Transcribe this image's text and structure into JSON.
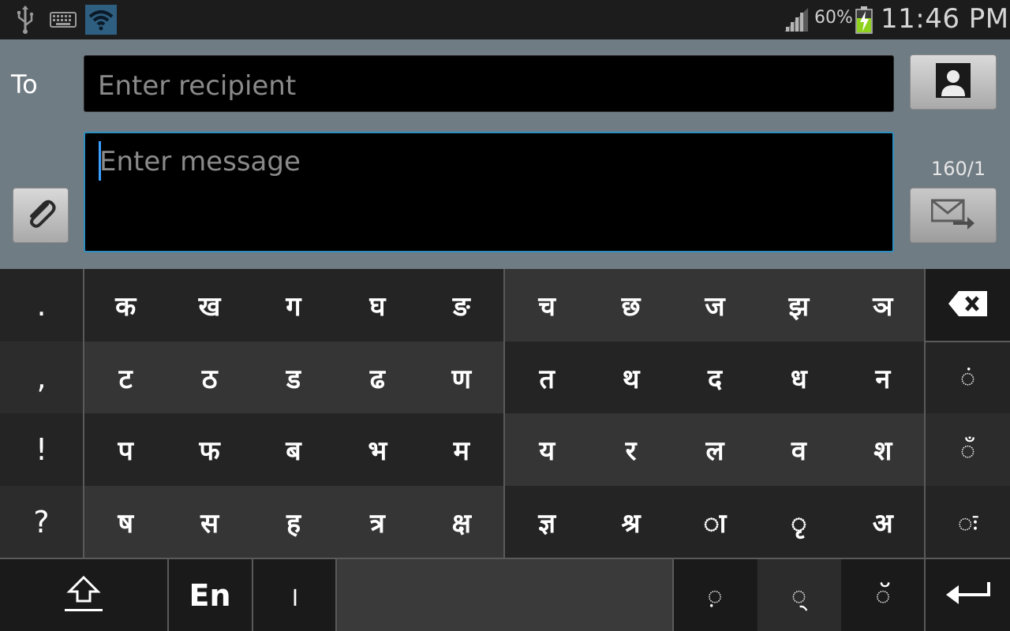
{
  "status_bar": {
    "icons": [
      "usb-icon",
      "keyboard-icon",
      "wifi-icon",
      "signal-icon",
      "battery-charging-icon"
    ],
    "battery_percent": "60%",
    "time": "11:46 PM"
  },
  "compose": {
    "to_label": "To",
    "recipient_placeholder": "Enter recipient",
    "message_placeholder": "Enter message",
    "char_counter": "160/1",
    "contacts_icon": "contact-icon",
    "attach_icon": "paperclip-icon",
    "send_icon": "send-message-icon"
  },
  "keyboard": {
    "left_column": [
      ".",
      ",",
      "!",
      "?"
    ],
    "rows_left": [
      [
        "क",
        "ख",
        "ग",
        "घ",
        "ङ"
      ],
      [
        "ट",
        "ठ",
        "ड",
        "ढ",
        "ण"
      ],
      [
        "प",
        "फ",
        "ब",
        "भ",
        "म"
      ],
      [
        "ष",
        "स",
        "ह",
        "त्र",
        "क्ष"
      ]
    ],
    "rows_right": [
      [
        "च",
        "छ",
        "ज",
        "झ",
        "ञ"
      ],
      [
        "त",
        "थ",
        "द",
        "ध",
        "न"
      ],
      [
        "य",
        "र",
        "ल",
        "व",
        "श"
      ],
      [
        "ज्ञ",
        "श्र",
        "◌ा",
        "◌ृ",
        "अ"
      ]
    ],
    "right_column": [
      "backspace-icon",
      "◌ं",
      "◌ँ",
      "◌ः"
    ],
    "bottom_row": {
      "shift_icon": "shift-icon",
      "language_label": "En",
      "danda": "।",
      "space_label": "",
      "matra_keys": [
        "◌़",
        "◌्",
        "◌ॅ"
      ],
      "enter_icon": "enter-icon"
    }
  }
}
